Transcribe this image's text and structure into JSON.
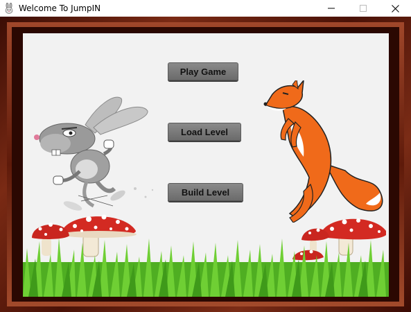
{
  "window": {
    "title": "Welcome To JumpIN",
    "icon": "rabbit-icon",
    "controls": [
      "minimize-icon",
      "maximize-icon",
      "close-icon"
    ]
  },
  "menu": {
    "play_label": "Play Game",
    "load_label": "Load Level",
    "build_label": "Build Level"
  },
  "scene": {
    "characters": [
      "rabbit",
      "fox"
    ],
    "decor": [
      "mushrooms",
      "grass"
    ]
  },
  "colors": {
    "frame": "#5e1a0a",
    "canvas": "#f2f2f2",
    "button": "#7a7a7a",
    "fox": "#f06a1a",
    "mushroom": "#d8342a",
    "grass": "#5cbf2a"
  }
}
